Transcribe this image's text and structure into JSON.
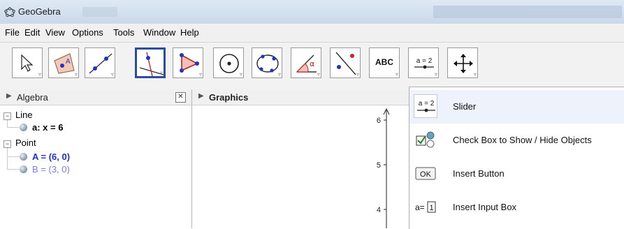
{
  "window": {
    "title": "GeoGebra"
  },
  "menu": {
    "items": [
      "File",
      "Edit",
      "View",
      "Options",
      "Tools",
      "Window",
      "Help"
    ]
  },
  "toolbar": {
    "tools": [
      {
        "icon": "move-arrow-icon"
      },
      {
        "icon": "point-icon",
        "glyph": "A"
      },
      {
        "icon": "line-through-two-points-icon"
      },
      {
        "icon": "perpendicular-line-icon"
      },
      {
        "icon": "polygon-icon"
      },
      {
        "icon": "circle-center-point-icon"
      },
      {
        "icon": "conic-five-points-icon"
      },
      {
        "icon": "angle-icon",
        "glyph": "α"
      },
      {
        "icon": "reflect-about-line-icon"
      },
      {
        "icon": "insert-text-icon",
        "glyph": "ABC"
      },
      {
        "icon": "slider-icon",
        "glyph": "a = 2"
      },
      {
        "icon": "move-graphics-view-icon"
      }
    ],
    "selected_index": 3
  },
  "algebra": {
    "title": "Algebra",
    "close": "✕",
    "groups": [
      {
        "name": "Line",
        "items": [
          {
            "text": "a: x = 6",
            "color": "#000000",
            "bold": true
          }
        ]
      },
      {
        "name": "Point",
        "items": [
          {
            "text": "A = (6, 0)",
            "color": "#1f2fd6",
            "bold": true
          },
          {
            "text": "B = (3, 0)",
            "color": "#7b7bef",
            "bold": false
          }
        ]
      }
    ]
  },
  "graphics": {
    "title": "Graphics",
    "y_ticks": [
      "6",
      "5",
      "4"
    ]
  },
  "slider_menu": {
    "items": [
      {
        "label": "Slider",
        "icon": "slider-icon",
        "glyph": "a = 2"
      },
      {
        "label": "Check Box to Show / Hide Objects",
        "icon": "checkbox-icon"
      },
      {
        "label": "Insert Button",
        "icon": "button-icon",
        "glyph": "OK"
      },
      {
        "label": "Insert Input Box",
        "icon": "input-box-icon",
        "glyph": "a=",
        "glyph2": "1"
      }
    ],
    "hover_index": 0
  },
  "colors": {
    "accent": "#2a4d9c",
    "point_blue": "#1f2fd6",
    "point_light": "#7b7bef"
  }
}
